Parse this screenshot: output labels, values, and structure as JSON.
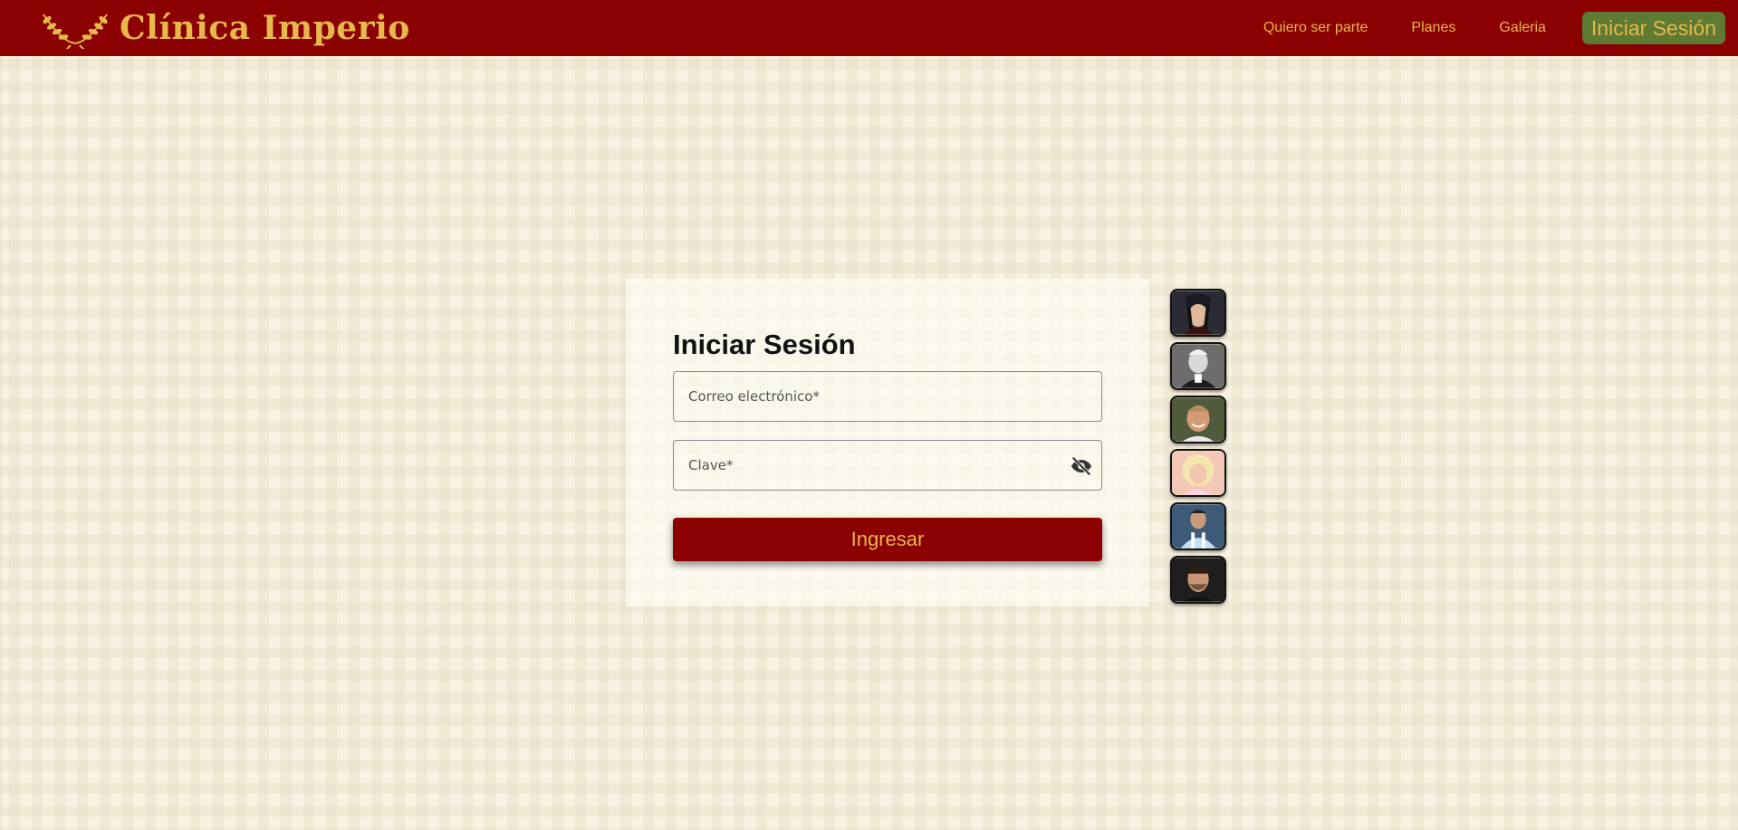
{
  "header": {
    "brand_title": "Clínica Imperio",
    "nav": [
      "Quiero ser parte",
      "Planes",
      "Galeria"
    ],
    "login_button": "Iniciar Sesión"
  },
  "login": {
    "title": "Iniciar Sesión",
    "email_placeholder": "Correo electrónico*",
    "password_placeholder": "Clave*",
    "submit_label": "Ingresar"
  },
  "avatars": [
    "avatar-ninja",
    "avatar-elderly-man",
    "avatar-man-smiling",
    "avatar-blonde-woman",
    "avatar-football-player",
    "avatar-young-man"
  ],
  "colors": {
    "brand_red": "#8b0000",
    "brand_gold": "#e7b84a",
    "login_green": "#5f7a32",
    "background": "#f7f2e1"
  },
  "icons": {
    "logo": "laurel-wreath-icon",
    "password_toggle": "eye-off-icon"
  }
}
